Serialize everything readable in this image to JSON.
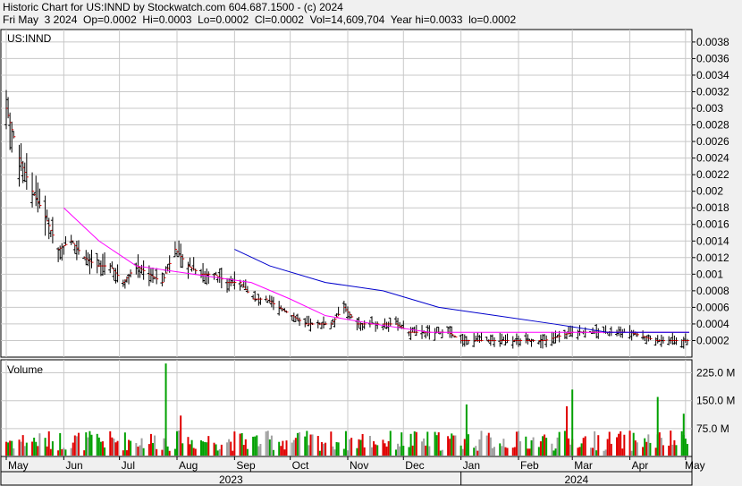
{
  "header": {
    "line1": "Historic Chart for US:INND by Stockwatch.com 604.687.1500 - (c) 2024",
    "line2": "Fri May  3 2024  Op=0.0002  Hi=0.0003  Lo=0.0002  Cl=0.0002  Vol=14,609,704  Year hi=0.0033  lo=0.0002"
  },
  "price_panel": {
    "symbol": "US:INND",
    "yticks": [
      "0.0038",
      "0.0036",
      "0.0034",
      "0.0032",
      "0.003",
      "0.0028",
      "0.0026",
      "0.0024",
      "0.0022",
      "0.002",
      "0.0018",
      "0.0016",
      "0.0014",
      "0.0012",
      "0.001",
      "0.0008",
      "0.0006",
      "0.0004",
      "0.0002"
    ]
  },
  "volume_panel": {
    "label": "Volume",
    "yticks": [
      "225.0 M",
      "150.0 M",
      "75.0 M"
    ]
  },
  "xaxis": {
    "months": [
      "May",
      "Jun",
      "Jul",
      "Aug",
      "Sep",
      "Oct",
      "Nov",
      "Dec",
      "Jan",
      "Feb",
      "Mar",
      "Apr",
      "May"
    ],
    "years": [
      "2023",
      "2024"
    ]
  },
  "colors": {
    "up": "#00a000",
    "down": "#e00000",
    "flat": "#a0a0a0",
    "bar": "#000000",
    "ma_short": "#ff00ff",
    "ma_long": "#0000cc",
    "grid": "#c8c8c8",
    "background": "#ffffff"
  },
  "chart_data": [
    {
      "type": "ohlc",
      "title": "US:INND",
      "ylim": [
        0.0,
        0.00395
      ],
      "x_range": [
        "2023-05-01",
        "2024-05-03"
      ],
      "last_bar": {
        "open": 0.0002,
        "high": 0.0003,
        "low": 0.0002,
        "close": 0.0002,
        "volume": 14609704
      },
      "year_high": 0.0033,
      "year_low": 0.0002,
      "approx_path": [
        {
          "date": "2023-05-01",
          "close": 0.003
        },
        {
          "date": "2023-05-08",
          "close": 0.0024
        },
        {
          "date": "2023-05-15",
          "close": 0.002
        },
        {
          "date": "2023-05-22",
          "close": 0.0017
        },
        {
          "date": "2023-05-29",
          "close": 0.0013
        },
        {
          "date": "2023-06-05",
          "close": 0.0014
        },
        {
          "date": "2023-06-12",
          "close": 0.0012
        },
        {
          "date": "2023-06-19",
          "close": 0.0011
        },
        {
          "date": "2023-06-26",
          "close": 0.0011
        },
        {
          "date": "2023-07-03",
          "close": 0.0009
        },
        {
          "date": "2023-07-10",
          "close": 0.0011
        },
        {
          "date": "2023-07-17",
          "close": 0.001
        },
        {
          "date": "2023-07-24",
          "close": 0.0009
        },
        {
          "date": "2023-07-31",
          "close": 0.0013
        },
        {
          "date": "2023-08-07",
          "close": 0.0011
        },
        {
          "date": "2023-08-14",
          "close": 0.001
        },
        {
          "date": "2023-08-21",
          "close": 0.001
        },
        {
          "date": "2023-08-28",
          "close": 0.0009
        },
        {
          "date": "2023-09-04",
          "close": 0.0009
        },
        {
          "date": "2023-09-11",
          "close": 0.0007
        },
        {
          "date": "2023-09-18",
          "close": 0.0007
        },
        {
          "date": "2023-09-25",
          "close": 0.0006
        },
        {
          "date": "2023-10-02",
          "close": 0.0005
        },
        {
          "date": "2023-10-09",
          "close": 0.0004
        },
        {
          "date": "2023-10-16",
          "close": 0.0004
        },
        {
          "date": "2023-10-23",
          "close": 0.0004
        },
        {
          "date": "2023-10-30",
          "close": 0.0006
        },
        {
          "date": "2023-11-06",
          "close": 0.0004
        },
        {
          "date": "2023-11-13",
          "close": 0.0004
        },
        {
          "date": "2023-11-20",
          "close": 0.0004
        },
        {
          "date": "2023-11-27",
          "close": 0.0004
        },
        {
          "date": "2023-12-04",
          "close": 0.0003
        },
        {
          "date": "2023-12-11",
          "close": 0.0003
        },
        {
          "date": "2023-12-18",
          "close": 0.0003
        },
        {
          "date": "2023-12-25",
          "close": 0.0003
        },
        {
          "date": "2024-01-01",
          "close": 0.0002
        },
        {
          "date": "2024-01-15",
          "close": 0.0002
        },
        {
          "date": "2024-02-01",
          "close": 0.0002
        },
        {
          "date": "2024-02-15",
          "close": 0.0002
        },
        {
          "date": "2024-03-01",
          "close": 0.0003
        },
        {
          "date": "2024-03-15",
          "close": 0.0003
        },
        {
          "date": "2024-04-01",
          "close": 0.0003
        },
        {
          "date": "2024-04-15",
          "close": 0.0002
        },
        {
          "date": "2024-05-03",
          "close": 0.0002
        }
      ],
      "moving_averages": [
        {
          "color": "#ff00ff",
          "points": [
            {
              "date": "2023-06-01",
              "value": 0.0018
            },
            {
              "date": "2023-06-20",
              "value": 0.0014
            },
            {
              "date": "2023-07-10",
              "value": 0.0011
            },
            {
              "date": "2023-08-10",
              "value": 0.001
            },
            {
              "date": "2023-09-10",
              "value": 0.0009
            },
            {
              "date": "2023-10-01",
              "value": 0.0007
            },
            {
              "date": "2023-10-20",
              "value": 0.0005
            },
            {
              "date": "2023-11-15",
              "value": 0.0004
            },
            {
              "date": "2023-12-15",
              "value": 0.0003
            },
            {
              "date": "2024-01-15",
              "value": 0.0003
            },
            {
              "date": "2024-03-01",
              "value": 0.0003
            },
            {
              "date": "2024-05-03",
              "value": 0.0003
            }
          ]
        },
        {
          "color": "#0000cc",
          "points": [
            {
              "date": "2023-09-01",
              "value": 0.0013
            },
            {
              "date": "2023-09-20",
              "value": 0.0011
            },
            {
              "date": "2023-10-20",
              "value": 0.0009
            },
            {
              "date": "2023-11-20",
              "value": 0.0008
            },
            {
              "date": "2023-12-20",
              "value": 0.0006
            },
            {
              "date": "2024-01-20",
              "value": 0.0005
            },
            {
              "date": "2024-02-20",
              "value": 0.0004
            },
            {
              "date": "2024-03-20",
              "value": 0.0003
            },
            {
              "date": "2024-05-03",
              "value": 0.0003
            }
          ]
        }
      ]
    },
    {
      "type": "bar",
      "title": "Volume",
      "ylabel": "Volume",
      "ylim": [
        0,
        260000000
      ],
      "ticks": [
        75000000,
        150000000,
        225000000
      ],
      "spikes": [
        {
          "date": "2023-07-26",
          "value": 250000000,
          "color": "#00a000"
        },
        {
          "date": "2023-08-03",
          "value": 110000000,
          "color": "#e00000"
        },
        {
          "date": "2024-01-04",
          "value": 140000000,
          "color": "#00a000"
        },
        {
          "date": "2024-02-27",
          "value": 135000000,
          "color": "#e00000"
        },
        {
          "date": "2024-03-01",
          "value": 180000000,
          "color": "#00a000"
        },
        {
          "date": "2024-04-16",
          "value": 160000000,
          "color": "#00a000"
        },
        {
          "date": "2024-04-30",
          "value": 115000000,
          "color": "#00a000"
        }
      ]
    }
  ]
}
